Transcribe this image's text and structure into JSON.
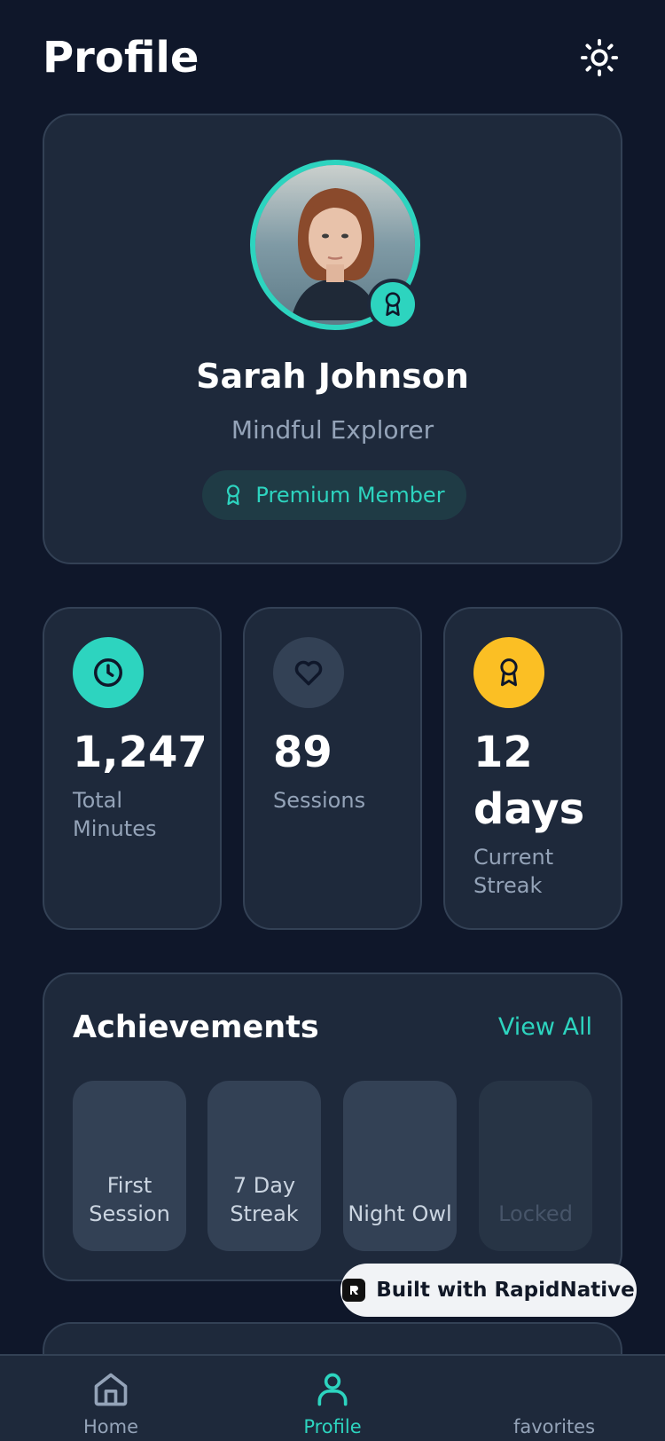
{
  "header": {
    "title": "Profile",
    "theme_icon": "sun-icon"
  },
  "profile": {
    "name": "Sarah Johnson",
    "subtitle": "Mindful Explorer",
    "badge": "Premium Member",
    "badge_icon": "award-icon",
    "accent": "#2dd4bf"
  },
  "stats": [
    {
      "value": "1,247",
      "label": "Total Minutes",
      "icon": "clock-icon",
      "color": "#2dd4bf"
    },
    {
      "value": "89",
      "label": "Sessions",
      "icon": "heart-icon",
      "color": "#334155"
    },
    {
      "value": "12 days",
      "label": "Current Streak",
      "icon": "award-icon",
      "color": "#fbbf24"
    }
  ],
  "achievements": {
    "title": "Achievements",
    "view_all": "View All",
    "items": [
      {
        "label": "First Session",
        "locked": false
      },
      {
        "label": "7 Day Streak",
        "locked": false
      },
      {
        "label": "Night Owl",
        "locked": false
      },
      {
        "label": "Locked",
        "locked": true
      }
    ]
  },
  "watermark": {
    "label": "Built with RapidNative"
  },
  "nav": {
    "items": [
      {
        "label": "Home",
        "icon": "home-icon",
        "active": false
      },
      {
        "label": "Profile",
        "icon": "user-icon",
        "active": true
      },
      {
        "label": "favorites",
        "icon": "",
        "active": false
      }
    ]
  }
}
